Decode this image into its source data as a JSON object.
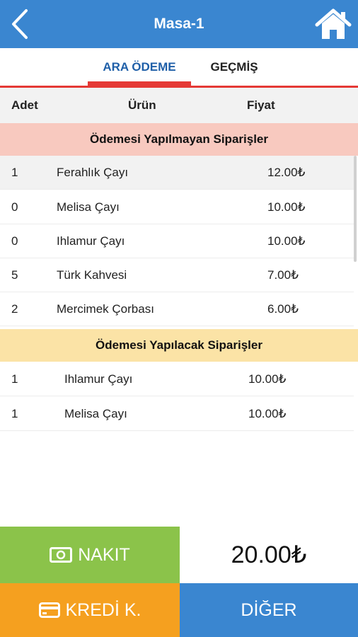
{
  "header": {
    "title": "Masa-1",
    "back_icon": "chevron-left-icon",
    "home_icon": "home-icon"
  },
  "tabs": [
    {
      "label": "ARA ÖDEME",
      "active": true
    },
    {
      "label": "GEÇMİŞ",
      "active": false
    }
  ],
  "table": {
    "columns": [
      "Adet",
      "Ürün",
      "Fiyat"
    ]
  },
  "unpaid": {
    "title": "Ödemesi Yapılmayan Siparişler",
    "rows": [
      {
        "qty": "1",
        "product": "Ferahlık Çayı",
        "price": "12.00₺"
      },
      {
        "qty": "0",
        "product": "Melisa Çayı",
        "price": "10.00₺"
      },
      {
        "qty": "0",
        "product": "Ihlamur Çayı",
        "price": "10.00₺"
      },
      {
        "qty": "5",
        "product": "Türk Kahvesi",
        "price": "7.00₺"
      },
      {
        "qty": "2",
        "product": "Mercimek Çorbası",
        "price": "6.00₺"
      }
    ]
  },
  "to_pay": {
    "title": "Ödemesi Yapılacak Siparişler",
    "rows": [
      {
        "qty": "1",
        "product": "Ihlamur Çayı",
        "price": "10.00₺"
      },
      {
        "qty": "1",
        "product": "Melisa Çayı",
        "price": "10.00₺"
      }
    ]
  },
  "footer": {
    "cash_label": "NAKIT",
    "cash_icon": "banknote-icon",
    "total": "20.00₺",
    "card_label": "KREDİ K.",
    "card_icon": "credit-card-icon",
    "other_label": "DİĞER"
  },
  "colors": {
    "primary": "#3a86d0",
    "accent_red": "#e53935",
    "cash_green": "#8bc34a",
    "card_orange": "#f5a01f",
    "unpaid_bg": "#f8c9bf",
    "topay_bg": "#fbe3a6"
  }
}
